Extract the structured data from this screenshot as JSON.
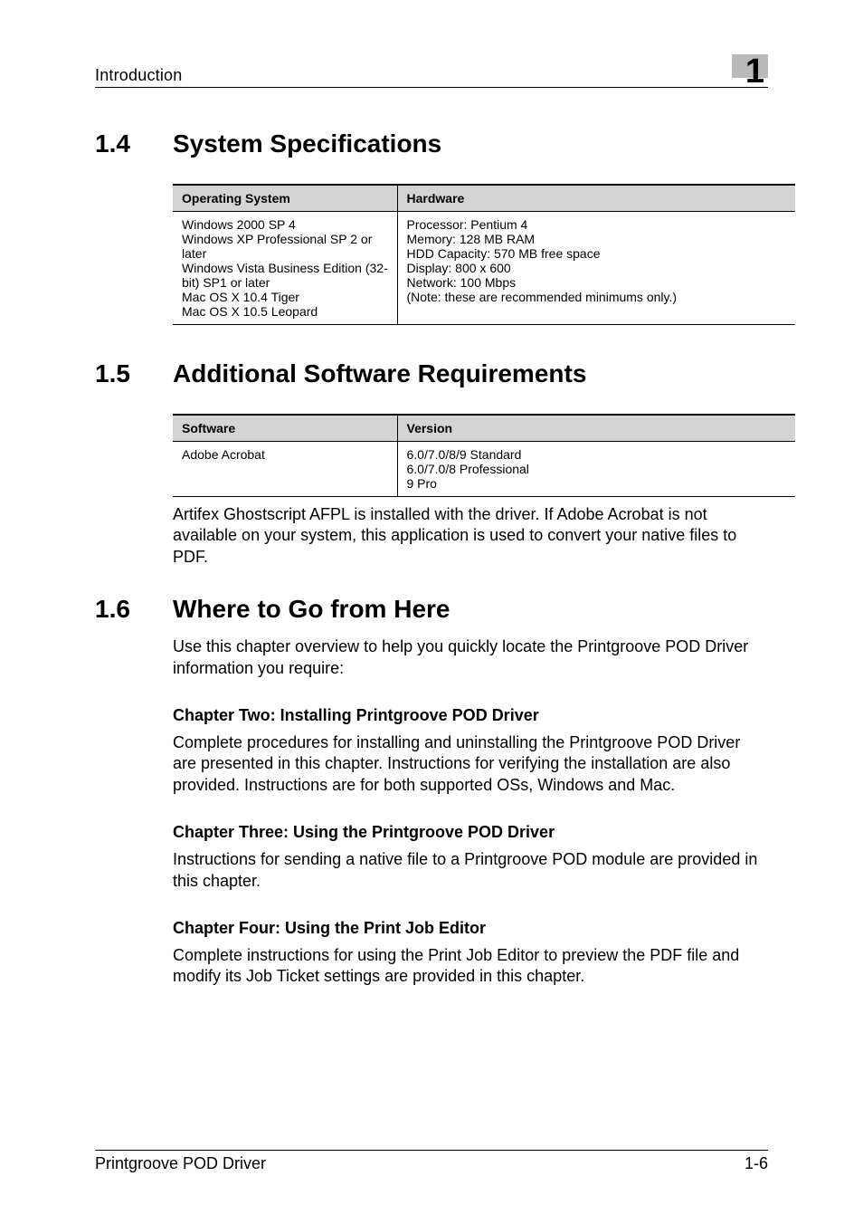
{
  "header": {
    "title": "Introduction",
    "chapter_number": "1"
  },
  "sections": {
    "s14": {
      "num": "1.4",
      "title": "System Specifications",
      "table": {
        "headers": [
          "Operating System",
          "Hardware"
        ],
        "rows": [
          {
            "col1": [
              "Windows 2000 SP 4",
              "Windows XP Professional SP 2 or later",
              "Windows Vista Business Edition (32-bit) SP1 or later",
              "Mac OS X 10.4 Tiger",
              "Mac OS X 10.5 Leopard"
            ],
            "col2": [
              "Processor: Pentium 4",
              "Memory: 128 MB RAM",
              "HDD Capacity: 570 MB free space",
              "Display: 800 x 600",
              "Network: 100 Mbps",
              "(Note: these are recommended minimums only.)"
            ]
          }
        ]
      }
    },
    "s15": {
      "num": "1.5",
      "title": "Additional Software Requirements",
      "table": {
        "headers": [
          "Software",
          "Version"
        ],
        "rows": [
          {
            "col1": [
              "Adobe Acrobat"
            ],
            "col2": [
              "6.0/7.0/8/9 Standard",
              "6.0/7.0/8 Professional",
              "9 Pro"
            ]
          }
        ]
      },
      "paragraph": "Artifex Ghostscript AFPL is installed with the driver. If Adobe Acrobat is not available on your system, this application is used to convert your native files to PDF."
    },
    "s16": {
      "num": "1.6",
      "title": "Where to Go from Here",
      "intro": "Use this chapter overview to help you quickly locate the Printgroove POD Driver information you require:",
      "subs": {
        "ch2": {
          "title": "Chapter Two: Installing Printgroove POD Driver",
          "body": "Complete procedures for installing and uninstalling the Printgroove POD Driver are presented in this chapter. Instructions for verifying the installation are also provided. Instructions are for both supported OSs, Windows and Mac."
        },
        "ch3": {
          "title": "Chapter Three: Using the Printgroove POD Driver",
          "body": "Instructions for sending a native file to a Printgroove POD module are provided in this chapter."
        },
        "ch4": {
          "title": "Chapter Four: Using the Print Job Editor",
          "body": "Complete instructions for using the Print Job Editor to preview the PDF file and modify its Job Ticket settings are provided in this chapter."
        }
      }
    }
  },
  "footer": {
    "left": "Printgroove POD Driver",
    "right": "1-6"
  }
}
